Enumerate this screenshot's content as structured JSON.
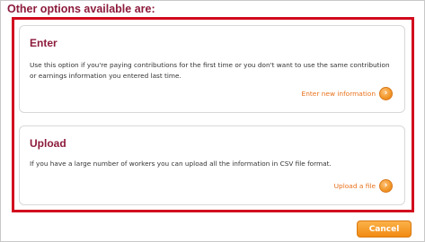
{
  "heading": "Other options available are:",
  "options": [
    {
      "title": "Enter",
      "description": "Use this option if you're paying contributions for the first time or you don't want to use the same contribution or earnings information you entered last time.",
      "link_label": "Enter new information",
      "link_icon": "arrow-right-circle-icon"
    },
    {
      "title": "Upload",
      "description": "If you have a large number of workers you can upload all the information in CSV file format.",
      "link_label": "Upload a file",
      "link_icon": "arrow-right-circle-icon"
    }
  ],
  "cancel_label": "Cancel",
  "colors": {
    "heading": "#8c1b3c",
    "highlight_border": "#d20a1e",
    "link": "#e8701a",
    "button": "#f18a12"
  }
}
